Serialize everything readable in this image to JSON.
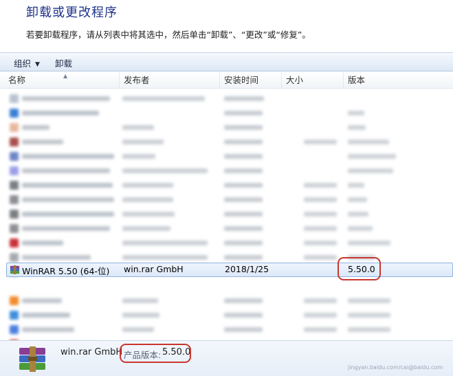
{
  "header": {
    "title": "卸载或更改程序",
    "description": "若要卸载程序，请从列表中将其选中，然后单击“卸载”、“更改”或“修复”。"
  },
  "toolbar": {
    "organize_label": "组织",
    "uninstall_label": "卸载"
  },
  "columns": {
    "name": "名称",
    "publisher": "发布者",
    "install_date": "安装时间",
    "size": "大小",
    "version": "版本"
  },
  "selected_program": {
    "name": "WinRAR 5.50 (64-位)",
    "publisher": "win.rar GmbH",
    "install_date": "2018/1/25",
    "version": "5.50.0"
  },
  "details": {
    "publisher": "win.rar GmbH",
    "version_label": "产品版本:",
    "version_value": "5.50.0"
  },
  "watermark": "jingyan.baidu.com/cai@baidu.com",
  "colors": {
    "title": "#1e3287",
    "highlight_oval": "#c8352f",
    "selection_border": "#8fb1df"
  }
}
